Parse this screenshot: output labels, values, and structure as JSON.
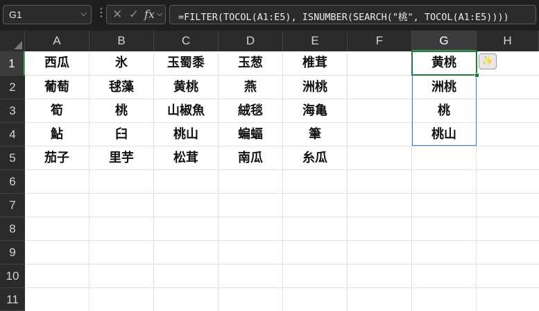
{
  "name_box": {
    "value": "G1",
    "dropdown_icon": "chevron-down-icon"
  },
  "formula_bar": {
    "cancel_icon": "close-icon",
    "enter_icon": "check-icon",
    "fx_label": "fx",
    "formula": "=FILTER(TOCOL(A1:E5), ISNUMBER(SEARCH(\"桃\", TOCOL(A1:E5))))"
  },
  "columns": [
    "A",
    "B",
    "C",
    "D",
    "E",
    "F",
    "G",
    "H"
  ],
  "rows": [
    "1",
    "2",
    "3",
    "4",
    "5",
    "6",
    "7",
    "8",
    "9",
    "10",
    "11"
  ],
  "cells": {
    "r1": [
      "西瓜",
      "氷",
      "玉蜀黍",
      "玉葱",
      "椎茸",
      "",
      "黄桃",
      ""
    ],
    "r2": [
      "葡萄",
      "毬藻",
      "黄桃",
      "燕",
      "洲桃",
      "",
      "洲桃",
      ""
    ],
    "r3": [
      "筍",
      "桃",
      "山椒魚",
      "絨毯",
      "海亀",
      "",
      "桃",
      ""
    ],
    "r4": [
      "鮎",
      "臼",
      "桃山",
      "蝙蝠",
      "筆",
      "",
      "桃山",
      ""
    ],
    "r5": [
      "茄子",
      "里芋",
      "松茸",
      "南瓜",
      "糸瓜",
      "",
      "",
      ""
    ]
  },
  "selected_column": "G",
  "selected_row": "1",
  "quick_analysis_icon": "sparkle-icon"
}
